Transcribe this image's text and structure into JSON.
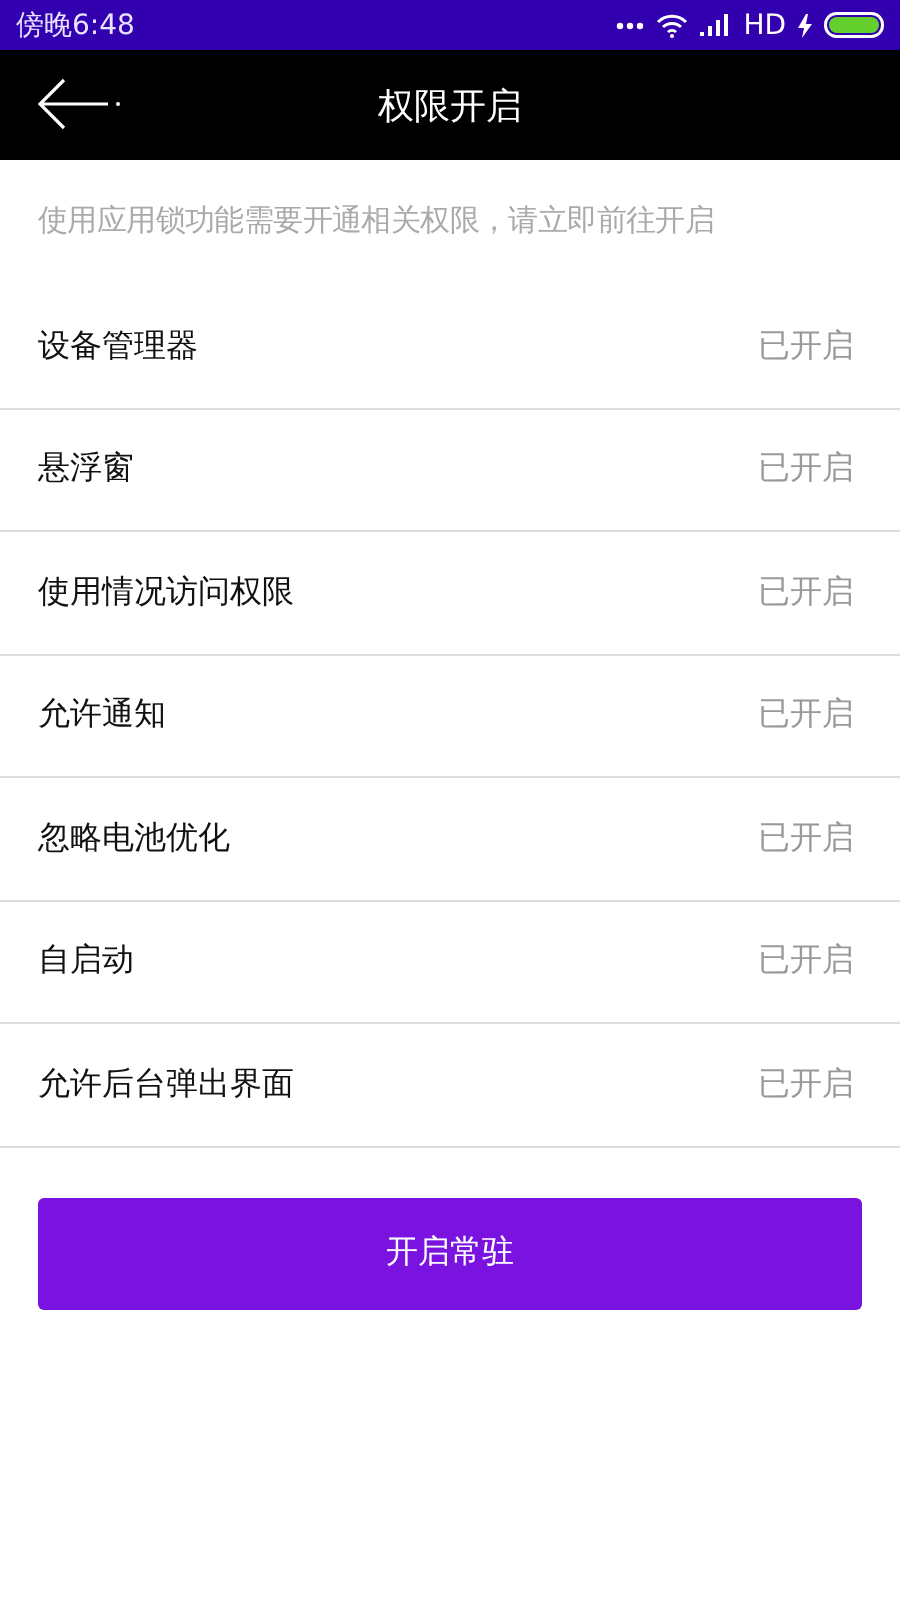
{
  "status_bar": {
    "time": "傍晚6:48",
    "network": "HD"
  },
  "header": {
    "title": "权限开启"
  },
  "intro": "使用应用锁功能需要开通相关权限，请立即前往开启",
  "permissions": [
    {
      "name": "设备管理器",
      "status": "已开启"
    },
    {
      "name": "悬浮窗",
      "status": "已开启"
    },
    {
      "name": "使用情况访问权限",
      "status": "已开启"
    },
    {
      "name": "允许通知",
      "status": "已开启"
    },
    {
      "name": "忽略电池优化",
      "status": "已开启"
    },
    {
      "name": "自启动",
      "status": "已开启"
    },
    {
      "name": "允许后台弹出界面",
      "status": "已开启"
    }
  ],
  "button": "开启常驻"
}
